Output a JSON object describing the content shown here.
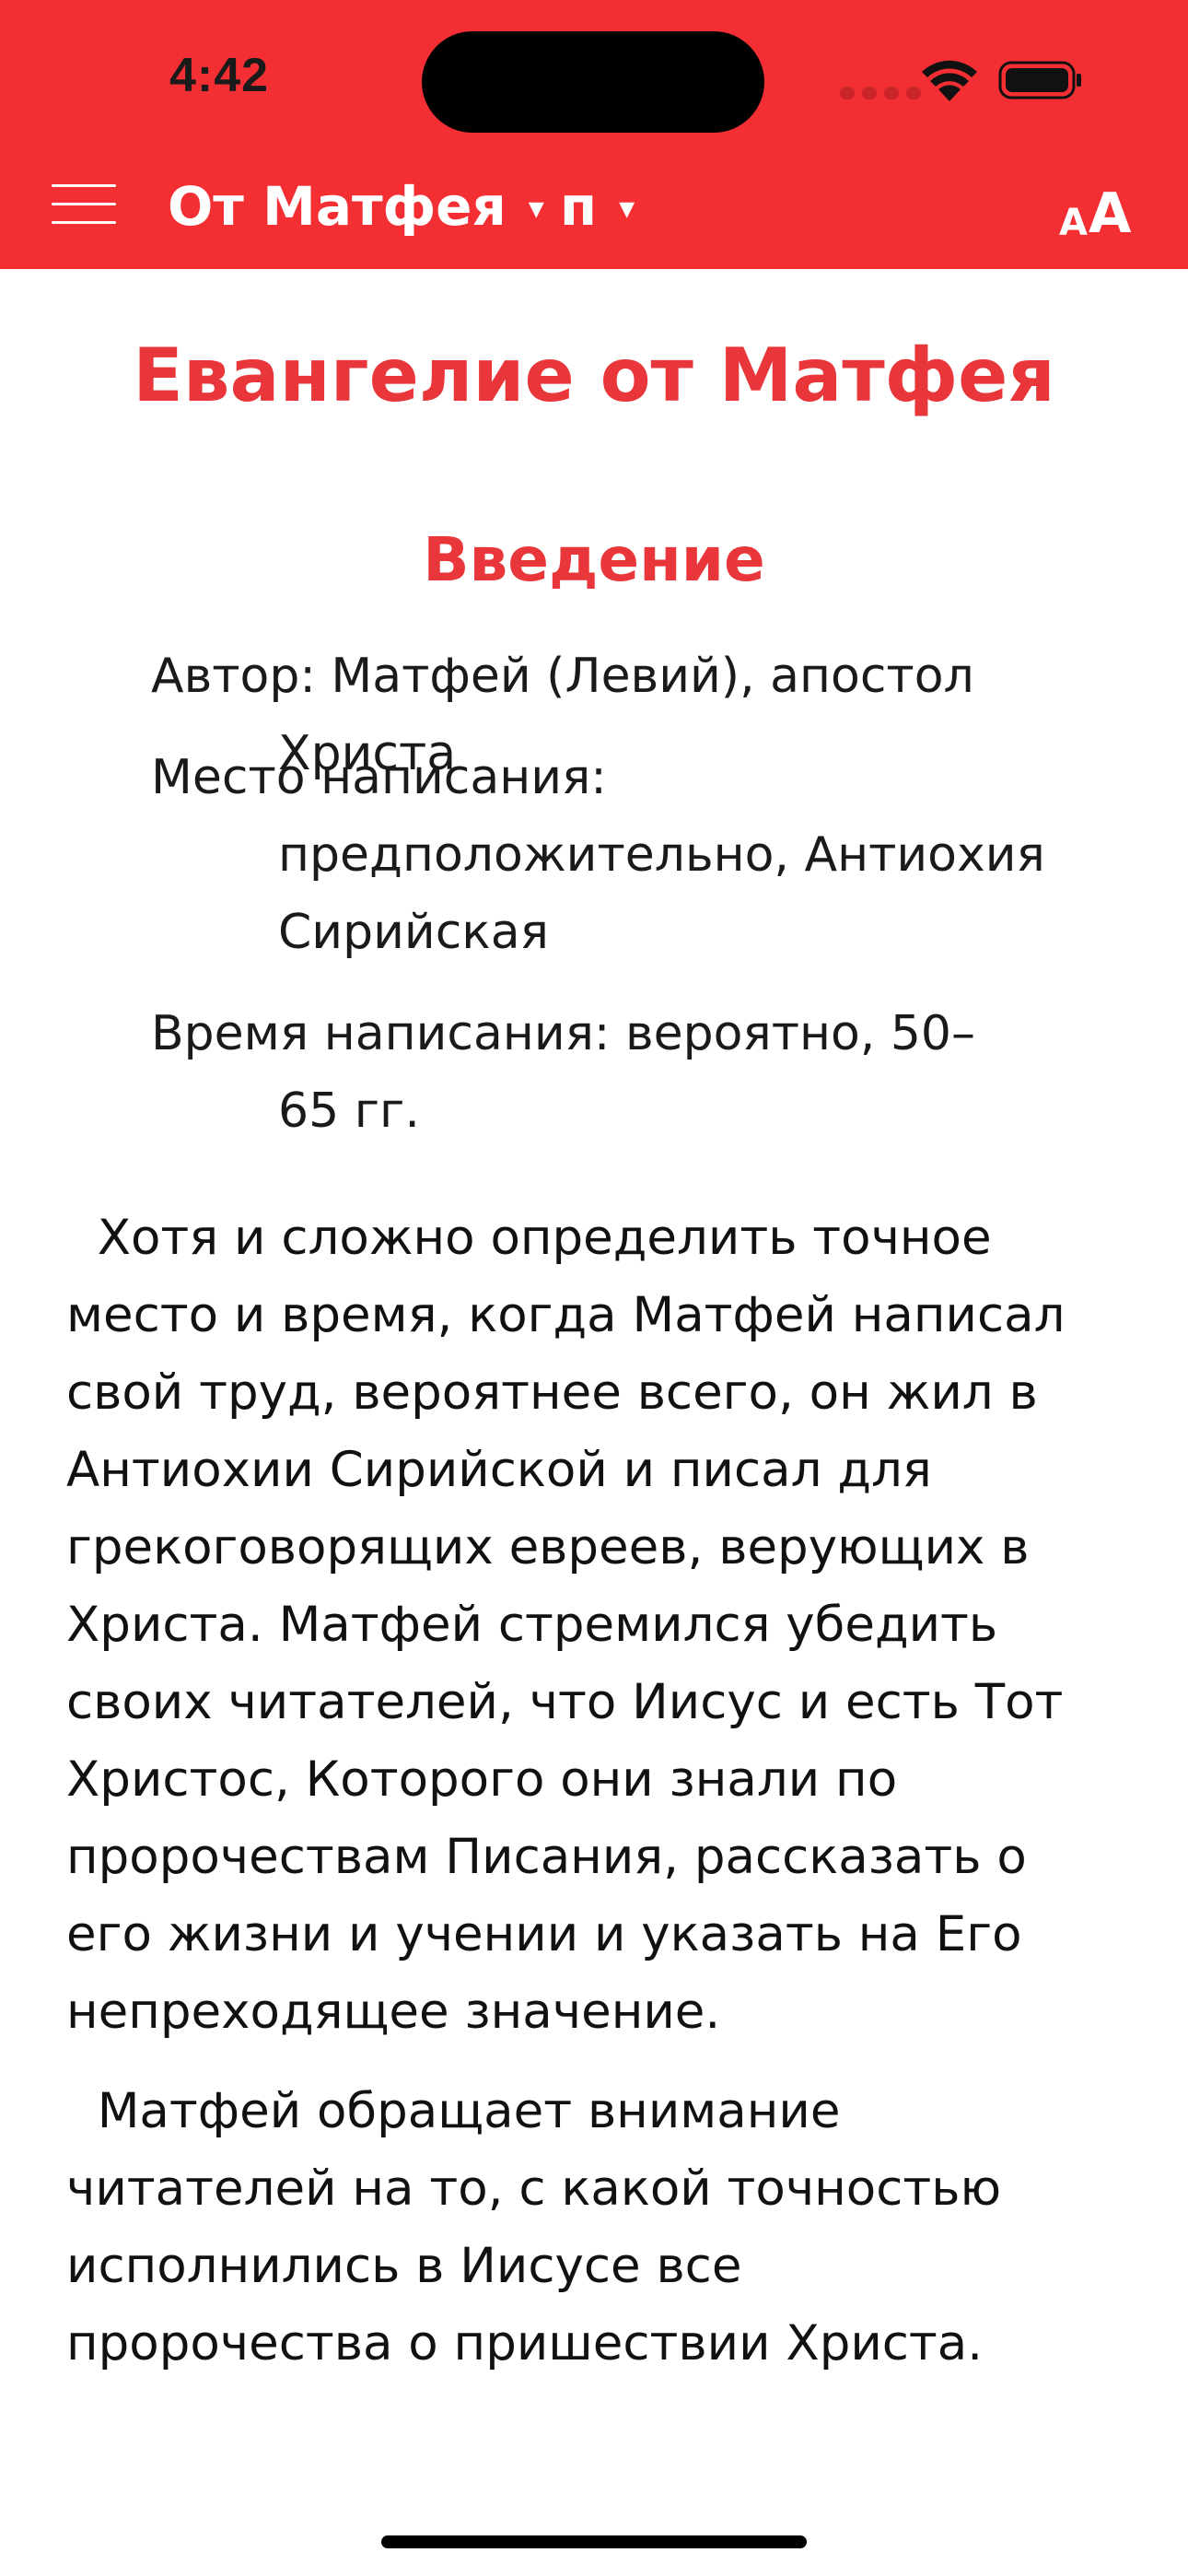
{
  "status_bar": {
    "time": "4:42"
  },
  "toolbar": {
    "book_label": "От Матфея",
    "book_caret": "▾",
    "chapter_label": "п",
    "chapter_caret": "▾",
    "font_small": "A",
    "font_big": "A"
  },
  "content": {
    "title": "Евангелие от Матфея",
    "subtitle": "Введение",
    "meta": [
      {
        "line1": "Автор: Матфей (Левий), апостол",
        "line2": "Христа"
      },
      {
        "line1": "Место написания:",
        "line2": "предположительно, Антиохия",
        "line3": "Сирийская"
      },
      {
        "line1": "Время написания: вероятно, 50–",
        "line2": "65 гг."
      }
    ],
    "paragraphs": [
      [
        "  Хотя и сложно определить точное",
        "место и время, когда Матфей написал",
        "свой труд, вероятнее всего, он жил в",
        "Антиохии Сирийской и писал для",
        "грекоговорящих евреев, верующих в",
        "Христа. Матфей стремился убедить",
        "своих читателей, что Иисус и есть Тот",
        "Христос, Которого они знали по",
        "пророчествам Писания, рассказать о",
        "его жизни и учении и указать на Его",
        "непреходящее значение."
      ],
      [
        "  Матфей обращает внимание",
        "читателей на то, с какой точностью",
        "исполнились в Иисусе все",
        "пророчества о пришествии Христа."
      ]
    ]
  },
  "colors": {
    "header_bg": "#f42f34",
    "accent_text": "#e9363a"
  }
}
